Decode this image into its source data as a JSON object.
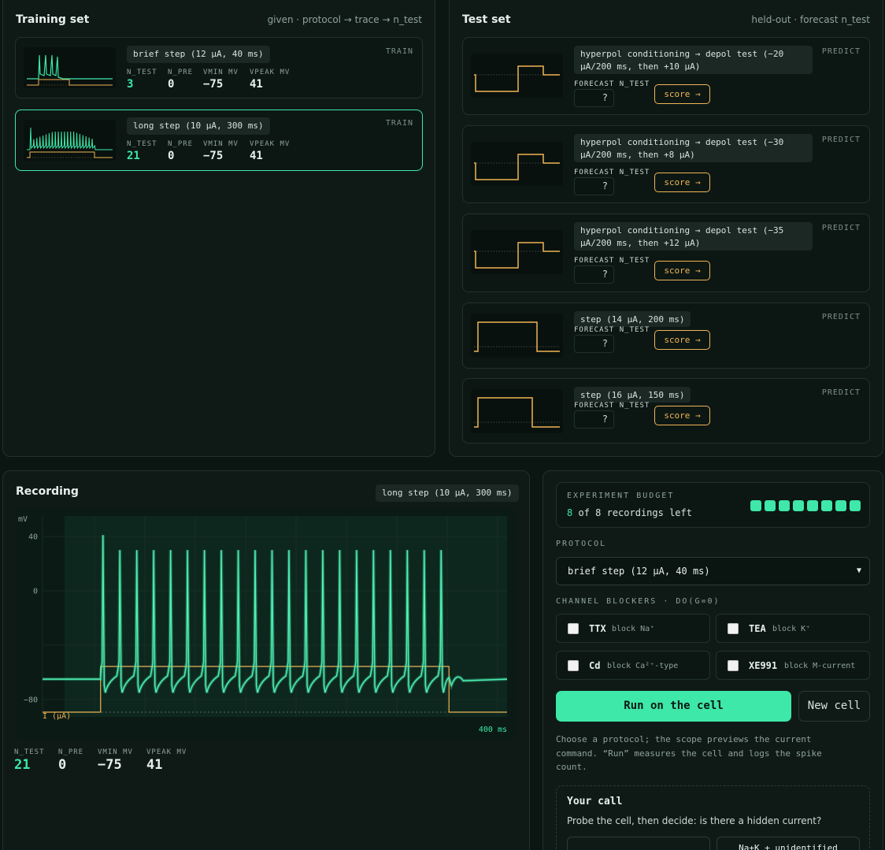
{
  "training": {
    "title": "Training set",
    "hint": "given · protocol → trace → n_test",
    "cards": [
      {
        "protocol": "brief step (12 µA, 40 ms)",
        "tag": "TRAIN",
        "n_test": "3",
        "n_pre": "0",
        "vmin": "−75",
        "vpeak": "41"
      },
      {
        "protocol": "long step (10 µA, 300 ms)",
        "tag": "TRAIN",
        "n_test": "21",
        "n_pre": "0",
        "vmin": "−75",
        "vpeak": "41"
      }
    ],
    "labels": {
      "n_test": "N_TEST",
      "n_pre": "N_PRE",
      "vmin": "VMIN MV",
      "vpeak": "VPEAK MV"
    }
  },
  "test": {
    "title": "Test set",
    "hint": "held-out · forecast n_test",
    "forecast_label": "FORECAST N_TEST",
    "score_label": "score →",
    "tag": "PREDICT",
    "cards": [
      {
        "line1": "hyperpol conditioning → depol test (−20",
        "line2": "µA/200 ms, then +10 µA)",
        "value": "?"
      },
      {
        "line1": "hyperpol conditioning → depol test (−30",
        "line2": "µA/200 ms, then +8 µA)",
        "value": "?"
      },
      {
        "line1": "hyperpol conditioning → depol test (−35",
        "line2": "µA/200 ms, then +12 µA)",
        "value": "?"
      },
      {
        "line1": "step (14 µA, 200 ms)",
        "line2": "",
        "value": "?"
      },
      {
        "line1": "step (16 µA, 150 ms)",
        "line2": "",
        "value": "?"
      }
    ]
  },
  "recording": {
    "title": "Recording",
    "protocol": "long step (10 µA, 300 ms)",
    "y_unit": "mV",
    "y_ticks": [
      "40",
      "0",
      "−80"
    ],
    "current_label": "I (µA)",
    "time_label": "400 ms",
    "stats": {
      "n_test": "21",
      "n_pre": "0",
      "vmin": "−75",
      "vpeak": "41"
    },
    "chart_data": {
      "type": "line",
      "title": "",
      "xlabel": "",
      "ylabel": "mV",
      "xlim": [
        0,
        400
      ],
      "ylim": [
        -100,
        50
      ],
      "series": [
        {
          "name": "",
          "kind": "membrane voltage",
          "spike_count": 21,
          "rest_mv": -65,
          "peak_mv": 41,
          "trough_mv": -75,
          "stim_start_ms": 50,
          "stim_end_ms": 350
        },
        {
          "name": "I (µA)",
          "kind": "command current",
          "amplitude_ua": 10,
          "start_ms": 50,
          "end_ms": 350
        }
      ],
      "grid": true
    }
  },
  "controls": {
    "budget_label": "EXPERIMENT BUDGET",
    "budget_count": "8",
    "budget_text": "of 8 recordings left",
    "budget_total": 8,
    "budget_remaining": 8,
    "protocol_label": "PROTOCOL",
    "protocol_selected": "brief step (12 µA, 40 ms)",
    "blockers_label": "CHANNEL BLOCKERS · DO(G=0)",
    "blockers": [
      {
        "name": "TTX",
        "desc": "block Na⁺",
        "checked": false
      },
      {
        "name": "TEA",
        "desc": "block K⁺",
        "checked": false
      },
      {
        "name": "Cd",
        "desc": "block Ca²⁺-type",
        "checked": false
      },
      {
        "name": "XE991",
        "desc": "block M-current",
        "checked": false
      }
    ],
    "run_label": "Run on the cell",
    "new_label": "New cell",
    "help_text": "Choose a protocol; the scope previews the current command. “Run” measures the cell and logs the spike count.",
    "call_title": "Your call",
    "call_text": "Probe the cell, then decide: is there a hidden current?",
    "call_option": "Na+K + unidentified"
  },
  "colors": {
    "accent": "#3ee8a8",
    "warning": "#f0b454",
    "background": "#0b1512"
  }
}
